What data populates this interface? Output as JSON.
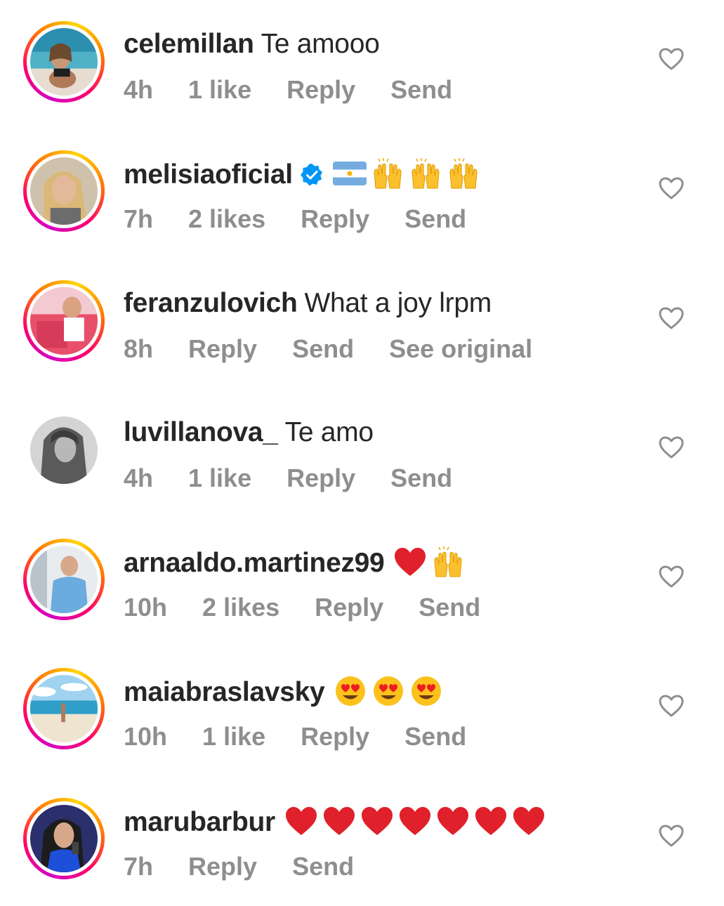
{
  "comments": [
    {
      "username": "celemillan",
      "text": "Te amooo",
      "time": "4h",
      "likes": "1 like",
      "reply": "Reply",
      "send": "Send",
      "extra": ""
    },
    {
      "username": "melisiaoficial",
      "text": "",
      "verified": true,
      "emoji": [
        "flag-argentina",
        "raising-hands",
        "raising-hands",
        "raising-hands"
      ],
      "time": "7h",
      "likes": "2 likes",
      "reply": "Reply",
      "send": "Send",
      "extra": ""
    },
    {
      "username": "feranzulovich",
      "text": "What a joy lrpm",
      "time": "8h",
      "likes": "",
      "reply": "Reply",
      "send": "Send",
      "extra": "See original"
    },
    {
      "username": "luvillanova_",
      "text": "Te amo",
      "time": "4h",
      "likes": "1 like",
      "reply": "Reply",
      "send": "Send",
      "extra": ""
    },
    {
      "username": "arnaaldo.martinez99",
      "text": "",
      "emoji": [
        "red-heart",
        "raising-hands"
      ],
      "time": "10h",
      "likes": "2 likes",
      "reply": "Reply",
      "send": "Send",
      "extra": ""
    },
    {
      "username": "maiabraslavsky",
      "text": "",
      "emoji": [
        "heart-eyes",
        "heart-eyes",
        "heart-eyes"
      ],
      "time": "10h",
      "likes": "1 like",
      "reply": "Reply",
      "send": "Send",
      "extra": ""
    },
    {
      "username": "marubarbur",
      "text": "",
      "emoji": [
        "red-heart",
        "red-heart",
        "red-heart",
        "red-heart",
        "red-heart",
        "red-heart",
        "red-heart"
      ],
      "time": "7h",
      "likes": "",
      "reply": "Reply",
      "send": "Send",
      "extra": ""
    }
  ],
  "colors": {
    "text": "#262626",
    "meta": "#8e8e8e",
    "verified": "#0095f6",
    "heart_outline": "#8e8e8e",
    "ring": [
      "#d300c5",
      "#ff0069",
      "#ff7a00",
      "#ffd600"
    ]
  },
  "icons": {
    "like": "heart-outline-icon",
    "verified": "verified-badge-icon"
  }
}
